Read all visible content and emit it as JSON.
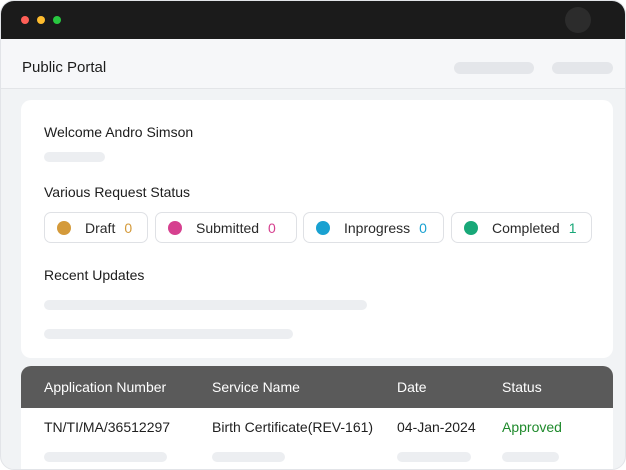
{
  "portal": {
    "title": "Public Portal"
  },
  "welcome": {
    "text": "Welcome Andro Simson"
  },
  "request_status": {
    "title": "Various Request Status",
    "items": [
      {
        "label": "Draft",
        "count": "0",
        "color": "#d49a3a"
      },
      {
        "label": "Submitted",
        "count": "0",
        "color": "#d6408f"
      },
      {
        "label": "Inprogress",
        "count": "0",
        "color": "#19a1d1"
      },
      {
        "label": "Completed",
        "count": "1",
        "color": "#18a878"
      }
    ]
  },
  "recent_updates": {
    "title": "Recent Updates"
  },
  "table": {
    "headers": [
      "Application Number",
      "Service Name",
      "Date",
      "Status"
    ],
    "rows": [
      [
        "TN/TI/MA/36512297",
        "Birth Certificate(REV-161)",
        "04-Jan-2024",
        "Approved"
      ]
    ],
    "status_color": "#1f8a2c"
  }
}
